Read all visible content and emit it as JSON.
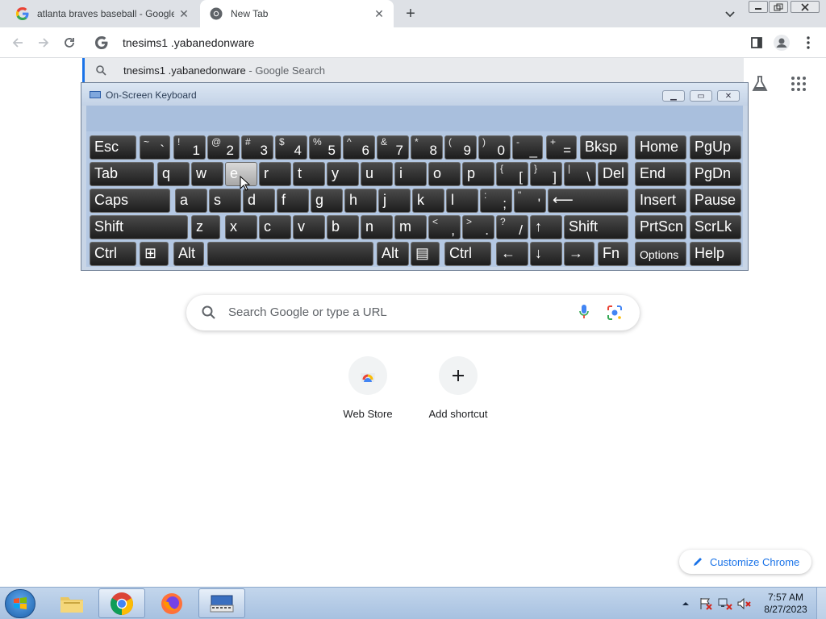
{
  "browser": {
    "tabs": [
      {
        "title": "atlanta braves baseball - Google Search",
        "active": false
      },
      {
        "title": "New Tab",
        "active": true
      }
    ],
    "omnibox": {
      "value": "tnesims1 .yabanedonware"
    },
    "suggestion": {
      "query": "tnesims1 .yabanedonware",
      "suffix": " - Google Search"
    }
  },
  "osk": {
    "title": "On-Screen Keyboard",
    "rows": [
      [
        {
          "label": "Esc"
        },
        {
          "shift": "~",
          "label": "`"
        },
        {
          "shift": "!",
          "label": "1"
        },
        {
          "shift": "@",
          "label": "2"
        },
        {
          "shift": "#",
          "label": "3"
        },
        {
          "shift": "$",
          "label": "4"
        },
        {
          "shift": "%",
          "label": "5"
        },
        {
          "shift": "^",
          "label": "6"
        },
        {
          "shift": "&",
          "label": "7"
        },
        {
          "shift": "*",
          "label": "8"
        },
        {
          "shift": "(",
          "label": "9"
        },
        {
          "shift": ")",
          "label": "0"
        },
        {
          "shift": "-",
          "label": "_"
        },
        {
          "shift": "+",
          "label": "="
        },
        {
          "label": "Bksp"
        },
        {
          "label": "Home"
        },
        {
          "label": "PgUp"
        }
      ],
      [
        {
          "label": "Tab"
        },
        {
          "label": "q"
        },
        {
          "label": "w"
        },
        {
          "label": "e",
          "pressed": true
        },
        {
          "label": "r"
        },
        {
          "label": "t"
        },
        {
          "label": "y"
        },
        {
          "label": "u"
        },
        {
          "label": "i"
        },
        {
          "label": "o"
        },
        {
          "label": "p"
        },
        {
          "shift": "{",
          "label": "["
        },
        {
          "shift": "}",
          "label": "]"
        },
        {
          "shift": "|",
          "label": "\\"
        },
        {
          "label": "Del"
        },
        {
          "label": "End"
        },
        {
          "label": "PgDn"
        }
      ],
      [
        {
          "label": "Caps"
        },
        {
          "label": "a"
        },
        {
          "label": "s"
        },
        {
          "label": "d"
        },
        {
          "label": "f"
        },
        {
          "label": "g"
        },
        {
          "label": "h"
        },
        {
          "label": "j"
        },
        {
          "label": "k"
        },
        {
          "label": "l"
        },
        {
          "shift": ":",
          "label": ";"
        },
        {
          "shift": "\"",
          "label": "'"
        },
        {
          "label": "⟵"
        },
        {
          "label": "Insert"
        },
        {
          "label": "Pause"
        }
      ],
      [
        {
          "label": "Shift"
        },
        {
          "label": "z"
        },
        {
          "label": "x"
        },
        {
          "label": "c"
        },
        {
          "label": "v"
        },
        {
          "label": "b"
        },
        {
          "label": "n"
        },
        {
          "label": "m"
        },
        {
          "shift": "<",
          "label": ","
        },
        {
          "shift": ">",
          "label": "."
        },
        {
          "shift": "?",
          "label": "/"
        },
        {
          "label": "↑"
        },
        {
          "label": "Shift"
        },
        {
          "label": "PrtScn"
        },
        {
          "label": "ScrLk"
        }
      ],
      [
        {
          "label": "Ctrl"
        },
        {
          "label": "⊞"
        },
        {
          "label": "Alt"
        },
        {
          "label": ""
        },
        {
          "label": "Alt"
        },
        {
          "label": "▤"
        },
        {
          "label": "Ctrl"
        },
        {
          "label": "←"
        },
        {
          "label": "↓"
        },
        {
          "label": "→"
        },
        {
          "label": "Fn"
        },
        {
          "label": "Options"
        },
        {
          "label": "Help"
        }
      ]
    ]
  },
  "ntp": {
    "search_placeholder": "Search Google or type a URL",
    "shortcuts": [
      {
        "label": "Web Store"
      },
      {
        "label": "Add shortcut"
      }
    ],
    "customize_label": "Customize Chrome"
  },
  "taskbar": {
    "time": "7:57 AM",
    "date": "8/27/2023"
  },
  "colors": {
    "accent": "#1a73e8",
    "tab_strip": "#dee1e6",
    "osk_frame": "#c8d5e6"
  }
}
